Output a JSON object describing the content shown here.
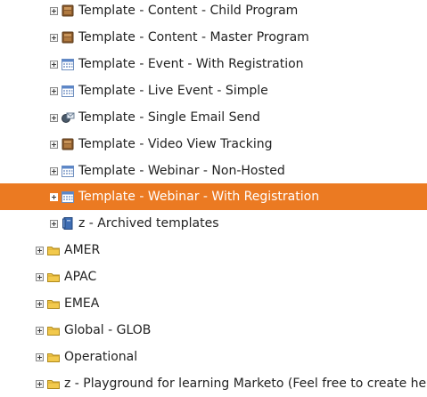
{
  "tree": {
    "items": [
      {
        "label": "Template - Content - Child Program",
        "icon": "program-icon"
      },
      {
        "label": "Template - Content - Master Program",
        "icon": "program-icon"
      },
      {
        "label": "Template - Event - With Registration",
        "icon": "event-calendar-icon"
      },
      {
        "label": "Template - Live Event - Simple",
        "icon": "event-calendar-icon"
      },
      {
        "label": "Template - Single Email Send",
        "icon": "email-program-icon"
      },
      {
        "label": "Template - Video View Tracking",
        "icon": "program-icon"
      },
      {
        "label": "Template - Webinar - Non-Hosted",
        "icon": "event-calendar-icon"
      },
      {
        "label": "Template - Webinar - With Registration",
        "icon": "event-calendar-icon",
        "selected": true
      },
      {
        "label": "z - Archived templates",
        "icon": "archive-folder-icon"
      },
      {
        "label": "AMER",
        "icon": "folder-icon"
      },
      {
        "label": "APAC",
        "icon": "folder-icon"
      },
      {
        "label": "EMEA",
        "icon": "folder-icon"
      },
      {
        "label": "Global - GLOB",
        "icon": "folder-icon"
      },
      {
        "label": "Operational",
        "icon": "folder-icon"
      },
      {
        "label": "z - Playground for learning Marketo (Feel free to create here)",
        "icon": "folder-icon"
      }
    ]
  },
  "colors": {
    "selected_background": "#eb7a22",
    "selected_text": "#ffffff",
    "text": "#222222"
  }
}
